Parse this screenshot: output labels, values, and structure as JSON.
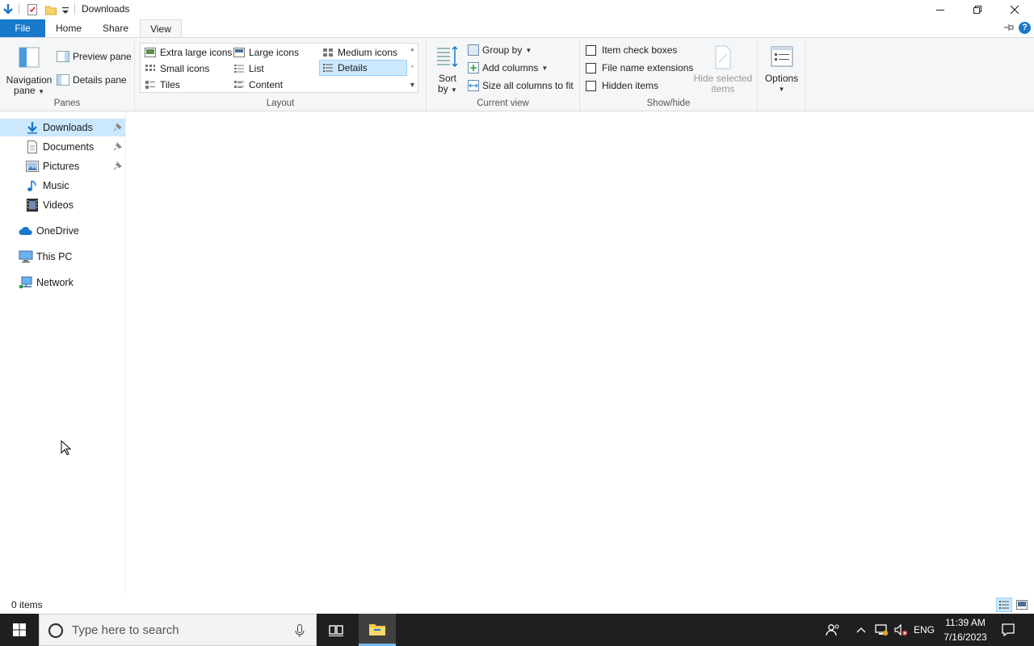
{
  "window": {
    "title": "Downloads"
  },
  "ribbon_tabs": {
    "file": "File",
    "home": "Home",
    "share": "Share",
    "view": "View"
  },
  "ribbon": {
    "panes": {
      "label": "Panes",
      "navigation_pane": "Navigation",
      "navigation_pane_2": "pane",
      "preview_pane": "Preview pane",
      "details_pane": "Details pane"
    },
    "layout": {
      "label": "Layout",
      "items": [
        "Extra large icons",
        "Large icons",
        "Medium icons",
        "Small icons",
        "List",
        "Details",
        "Tiles",
        "Content"
      ],
      "selected": "Details"
    },
    "current_view": {
      "label": "Current view",
      "sort_by": "Sort",
      "sort_by_2": "by",
      "group_by": "Group by",
      "add_columns": "Add columns",
      "size_columns": "Size all columns to fit"
    },
    "show_hide": {
      "label": "Show/hide",
      "item_check_boxes": "Item check boxes",
      "file_name_extensions": "File name extensions",
      "hidden_items": "Hidden items",
      "hide_selected": "Hide selected",
      "hide_selected_2": "items"
    },
    "options": {
      "label": "Options"
    }
  },
  "sidebar": {
    "items": [
      {
        "label": "Downloads",
        "pinned": true,
        "selected": true
      },
      {
        "label": "Documents",
        "pinned": true
      },
      {
        "label": "Pictures",
        "pinned": true
      },
      {
        "label": "Music"
      },
      {
        "label": "Videos"
      },
      {
        "label": "OneDrive"
      },
      {
        "label": "This PC"
      },
      {
        "label": "Network"
      }
    ]
  },
  "status": {
    "item_count": "0 items"
  },
  "taskbar": {
    "search_placeholder": "Type here to search",
    "language": "ENG",
    "time": "11:39 AM",
    "date": "7/16/2023"
  },
  "colors": {
    "accent": "#1979ca",
    "selection": "#cce8ff",
    "taskbar": "#1f1f1f"
  }
}
